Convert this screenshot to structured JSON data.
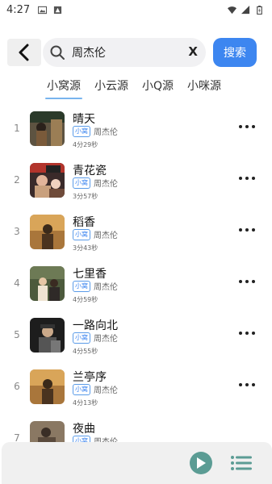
{
  "status_bar": {
    "time": "4:27"
  },
  "search": {
    "query": "周杰伦",
    "clear_label": "X",
    "button_label": "搜索"
  },
  "tabs": [
    {
      "label": "小窝源",
      "active": true
    },
    {
      "label": "小云源",
      "active": false
    },
    {
      "label": "小Q源",
      "active": false
    },
    {
      "label": "小咪源",
      "active": false
    }
  ],
  "songs": [
    {
      "index": "1",
      "title": "晴天",
      "source_badge": "小窝",
      "artist": "周杰伦",
      "duration": "4分29秒"
    },
    {
      "index": "2",
      "title": "青花瓷",
      "source_badge": "小窝",
      "artist": "周杰伦",
      "duration": "3分57秒"
    },
    {
      "index": "3",
      "title": "稻香",
      "source_badge": "小窝",
      "artist": "周杰伦",
      "duration": "3分43秒"
    },
    {
      "index": "4",
      "title": "七里香",
      "source_badge": "小窝",
      "artist": "周杰伦",
      "duration": "4分59秒"
    },
    {
      "index": "5",
      "title": "一路向北",
      "source_badge": "小窝",
      "artist": "周杰伦",
      "duration": "4分55秒"
    },
    {
      "index": "6",
      "title": "兰亭序",
      "source_badge": "小窝",
      "artist": "周杰伦",
      "duration": "4分13秒"
    },
    {
      "index": "7",
      "title": "夜曲",
      "source_badge": "小窝",
      "artist": "周杰伦",
      "duration": ""
    }
  ],
  "colors": {
    "accent": "#3d86f0",
    "tab_underline": "#78b4ee",
    "play_button": "#5b9c94",
    "player_bg": "#f0f0f0"
  },
  "icons": {
    "back": "chevron-left-icon",
    "search": "search-icon",
    "more": "more-horizontal-icon",
    "play": "play-icon",
    "playlist": "playlist-icon"
  }
}
